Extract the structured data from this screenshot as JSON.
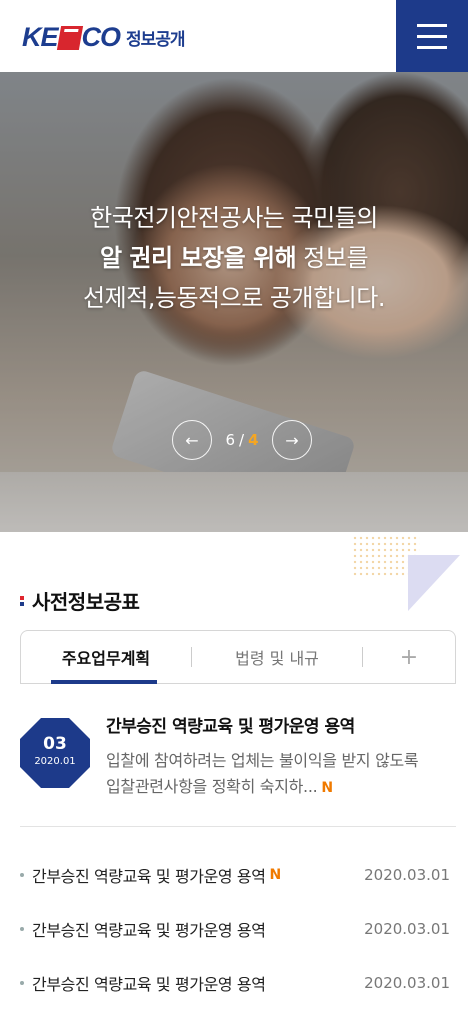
{
  "header": {
    "logo_text": "KESCO",
    "logo_sub": "정보공개",
    "menu_label": "menu"
  },
  "hero": {
    "line1": "한국전기안전공사는 국민들의",
    "line2_bold": "알 권리 보장을 위해",
    "line2_rest": " 정보를",
    "line3": "선제적,능동적으로 공개합니다.",
    "pager_current": "6",
    "pager_sep": "/",
    "pager_total": "4",
    "prev_icon": "←",
    "next_icon": "→"
  },
  "section": {
    "title": "사전정보공표",
    "colors": [
      "#e0262f",
      "#1d3a8a",
      "#f5a623"
    ]
  },
  "tabs": [
    {
      "label": "주요업무계획",
      "active": true
    },
    {
      "label": "법령 및 내규",
      "active": false
    },
    {
      "label": "+",
      "active": false
    }
  ],
  "feature": {
    "day": "03",
    "year_month": "2020.01",
    "title": "간부승진 역량교육 및 평가운영 용역",
    "desc": "입찰에 참여하려는 업체는 불이익을 받지 않도록 입찰관련사항을 정확히 숙지하...",
    "new_badge": "N"
  },
  "list": [
    {
      "title": "간부승진 역량교육 및 평가운영 용역",
      "new": "N",
      "date": "2020.03.01"
    },
    {
      "title": "간부승진 역량교육 및 평가운영 용역",
      "new": "",
      "date": "2020.03.01"
    },
    {
      "title": "간부승진 역량교육 및 평가운영 용역",
      "new": "",
      "date": "2020.03.01"
    }
  ]
}
